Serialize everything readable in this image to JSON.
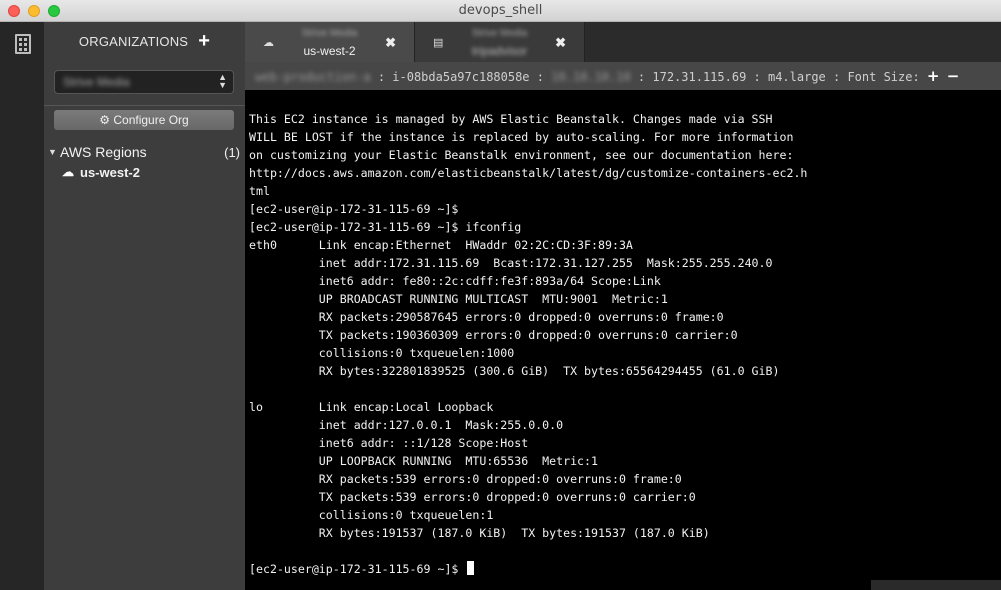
{
  "window": {
    "title": "devops_shell"
  },
  "sidebar": {
    "header": "ORGANIZATIONS",
    "org_select": "Strive Media",
    "configure_label": "⚙ Configure Org",
    "regions_label": "AWS Regions",
    "regions_count": "(1)",
    "region_item": "us-west-2"
  },
  "tabs": [
    {
      "sub": "Strive Media",
      "title": "us-west-2",
      "close": "✖"
    },
    {
      "sub": "Strive Media",
      "title": "tripadvisor",
      "close": "✖"
    }
  ],
  "infobar": {
    "name": "web-production-a",
    "instance_id": " : i-08bda5a97c188058e : ",
    "public_ip": "10.10.10.10",
    "details": " : 172.31.115.69 : m4.large : Font Size: ",
    "plus": "+",
    "minus": "−"
  },
  "terminal": {
    "lines": [
      "This EC2 instance is managed by AWS Elastic Beanstalk. Changes made via SSH",
      "WILL BE LOST if the instance is replaced by auto-scaling. For more information",
      "on customizing your Elastic Beanstalk environment, see our documentation here:",
      "http://docs.aws.amazon.com/elasticbeanstalk/latest/dg/customize-containers-ec2.h",
      "tml",
      "[ec2-user@ip-172-31-115-69 ~]$",
      "[ec2-user@ip-172-31-115-69 ~]$ ifconfig",
      "eth0      Link encap:Ethernet  HWaddr 02:2C:CD:3F:89:3A",
      "          inet addr:172.31.115.69  Bcast:172.31.127.255  Mask:255.255.240.0",
      "          inet6 addr: fe80::2c:cdff:fe3f:893a/64 Scope:Link",
      "          UP BROADCAST RUNNING MULTICAST  MTU:9001  Metric:1",
      "          RX packets:290587645 errors:0 dropped:0 overruns:0 frame:0",
      "          TX packets:190360309 errors:0 dropped:0 overruns:0 carrier:0",
      "          collisions:0 txqueuelen:1000",
      "          RX bytes:322801839525 (300.6 GiB)  TX bytes:65564294455 (61.0 GiB)",
      "",
      "lo        Link encap:Local Loopback",
      "          inet addr:127.0.0.1  Mask:255.0.0.0",
      "          inet6 addr: ::1/128 Scope:Host",
      "          UP LOOPBACK RUNNING  MTU:65536  Metric:1",
      "          RX packets:539 errors:0 dropped:0 overruns:0 frame:0",
      "          TX packets:539 errors:0 dropped:0 overruns:0 carrier:0",
      "          collisions:0 txqueuelen:1",
      "          RX bytes:191537 (187.0 KiB)  TX bytes:191537 (187.0 KiB)",
      ""
    ],
    "prompt": "[ec2-user@ip-172-31-115-69 ~]$ "
  }
}
